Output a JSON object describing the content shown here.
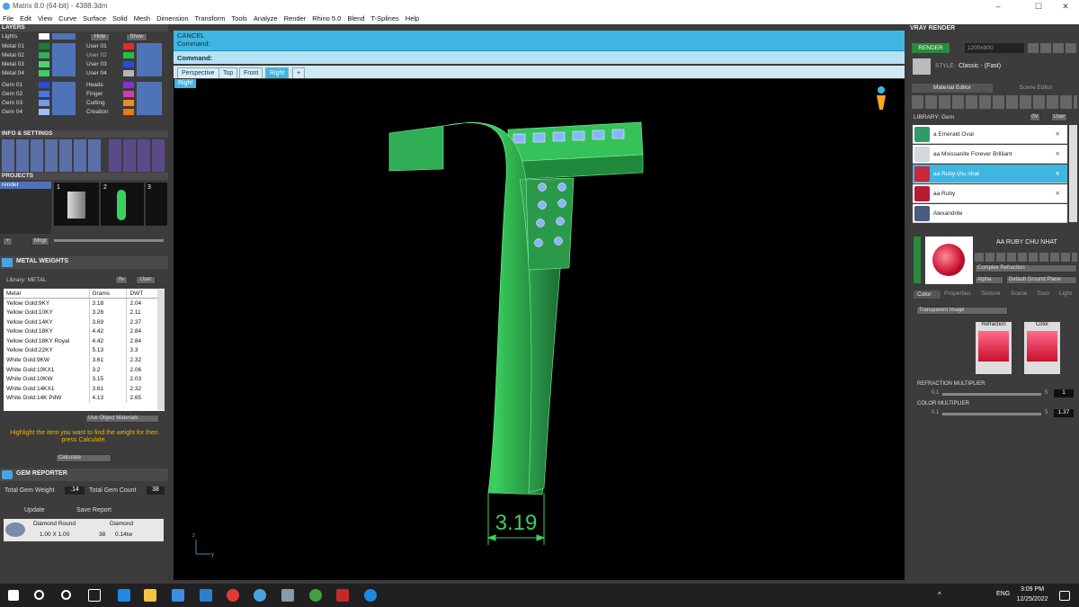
{
  "window": {
    "title": "Matrix 8.0 (64-bit) - 4388.3dm",
    "minimize": "–",
    "maximize": "☐",
    "close": "✕"
  },
  "menu": [
    "File",
    "Edit",
    "View",
    "Curve",
    "Surface",
    "Solid",
    "Mesh",
    "Dimension",
    "Transform",
    "Tools",
    "Analyze",
    "Render",
    "Rhino 5.0",
    "Blend",
    "T-Splines",
    "Help"
  ],
  "layers": {
    "header": "LAYERS",
    "rows_left": [
      "Lights",
      "Metal 01",
      "Metal 02",
      "Metal 03",
      "Metal 04",
      "Gem 01",
      "Gem 02",
      "Gem 03",
      "Gem 04"
    ],
    "rows_right": [
      "User 01",
      "User 02",
      "User 03",
      "User 04",
      "Heads",
      "Finger",
      "Cutting",
      "Creation"
    ],
    "hide": "Hide",
    "show": "Show"
  },
  "info": {
    "header": "INFO & SETTINGS"
  },
  "projects": {
    "header": "PROJECTS",
    "item": "render",
    "thumbs": [
      "1",
      "2",
      "3"
    ],
    "new_btn": "+",
    "save_btn": "Mngr"
  },
  "metal_weights": {
    "header": "METAL WEIGHTS",
    "library": "Library: METAL",
    "lib_btn": "0v",
    "user_btn": "User",
    "columns": [
      "Metal",
      "Grams",
      "DWT"
    ],
    "rows": [
      [
        "Yellow Gold:9KY",
        "3.18",
        "2.04"
      ],
      [
        "Yellow Gold:10KY",
        "3.28",
        "2.11"
      ],
      [
        "Yellow Gold:14KY",
        "3.69",
        "2.37"
      ],
      [
        "Yellow Gold:18KY",
        "4.42",
        "2.84"
      ],
      [
        "Yellow Gold:18KY Royal",
        "4.42",
        "2.84"
      ],
      [
        "Yellow Gold:22KY",
        "5.13",
        "3.3"
      ],
      [
        "White Gold:9KW",
        "3.61",
        "2.32"
      ],
      [
        "White Gold:10KX1",
        "3.2",
        "2.06"
      ],
      [
        "White Gold:10KW",
        "3.15",
        "2.03"
      ],
      [
        "White Gold:14KX1",
        "3.61",
        "2.32"
      ],
      [
        "White Gold:14K PdW",
        "4.13",
        "2.65"
      ]
    ],
    "use_object": "Use Object Materials",
    "hint": "Highlight the item you want to find the weight for then press Calculate.",
    "calculate": "Calculate"
  },
  "gem_reporter": {
    "header": "GEM REPORTER",
    "total_weight_label": "Total Gem Weight",
    "total_weight": ".14",
    "total_count_label": "Total Gem Count",
    "total_count": "38",
    "update": "Update",
    "save": "Save Report",
    "cut": "Diamond Round",
    "material": "Diamond",
    "size": "1.00 X 1.00",
    "count": "38",
    "weight": "0.14tw"
  },
  "command": {
    "line1": "CANCEL",
    "line2": "Command:",
    "prompt": "Command:"
  },
  "view_tabs": [
    "Perspective",
    "Top",
    "Front",
    "Right",
    "+"
  ],
  "viewport": {
    "label": "Right",
    "dimension": "3.19",
    "axis_z": "z",
    "axis_y": "y",
    "colors": {
      "model": "#3ad15f",
      "dark": "#1f7a34",
      "gem": "#8ab4ff"
    }
  },
  "vray": {
    "header": "VRAY RENDER",
    "render_btn": "RENDER",
    "resolution": "1200x900",
    "style_label": "STYLE:",
    "style": "Classic - (Fast)"
  },
  "material_editor": {
    "tab1": "Material Editor",
    "tab2": "Scene Editor",
    "library": "LIBRARY: Gem",
    "lib_btn": "0V",
    "user_btn": "User",
    "items": [
      {
        "name": "a Emerald Oval",
        "color": "#2f9b6a"
      },
      {
        "name": "aa Moissanite Forever Brilliant",
        "color": "#d0d8e0"
      },
      {
        "name": "aa Ruby chu nhat",
        "color": "#c8273d"
      },
      {
        "name": "aa Ruby",
        "color": "#b51c33"
      },
      {
        "name": "Alexandrite",
        "color": "#4a5a80"
      }
    ],
    "selected_name": "AA RUBY CHU NHAT",
    "type": "Complex Refraction",
    "alpha": "Alpha",
    "ground": "Default Ground Plane",
    "subtabs": [
      "Color",
      "Properties",
      "Texture",
      "Scene",
      "Toon",
      "Light"
    ],
    "transparent": "Transparent Image",
    "refraction": "Refraction",
    "color": "Color",
    "refr_mult_label": "REFRACTION MULTIPLIER",
    "refr_min": "0.1",
    "refr_max": "5",
    "refr_val": "1",
    "color_mult_label": "COLOR MULTIPLIER",
    "col_min": "0.1",
    "col_max": "5",
    "col_val": "1.37"
  },
  "taskbar": {
    "time": "3:09 PM",
    "date": "12/25/2022",
    "lang": "ENG"
  }
}
